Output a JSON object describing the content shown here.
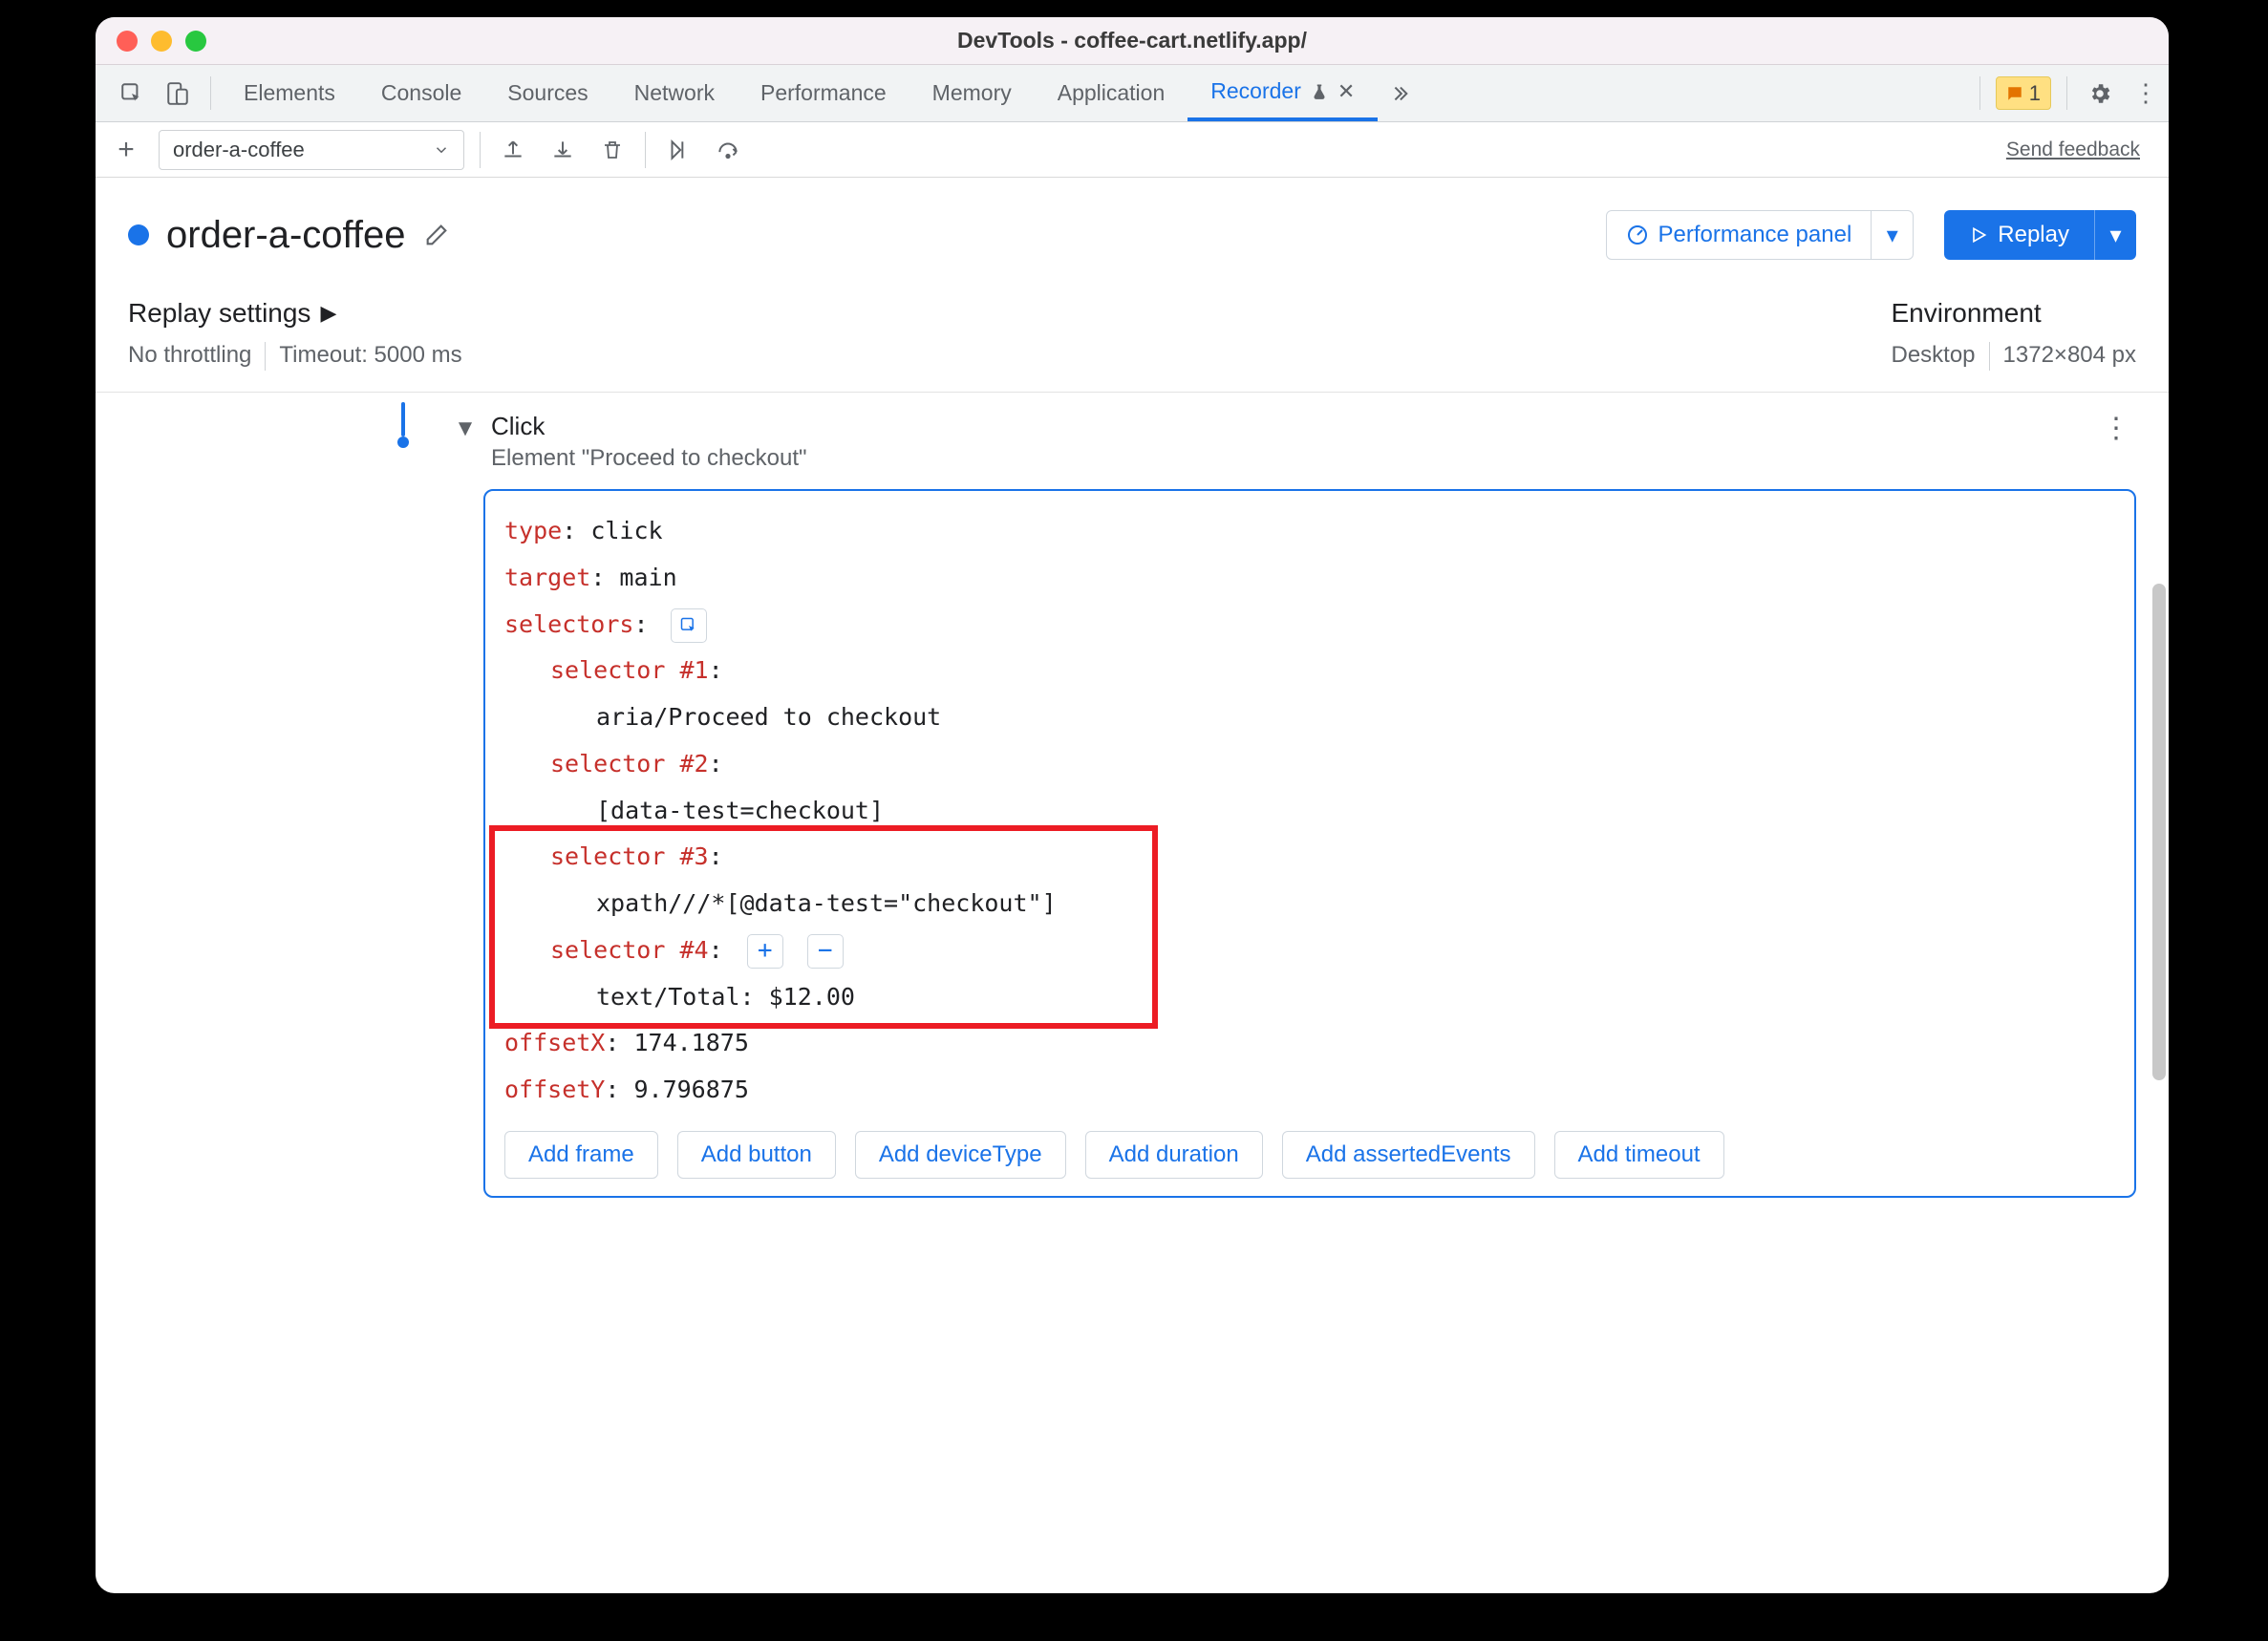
{
  "title": "DevTools - coffee-cart.netlify.app/",
  "tabs": {
    "elements": "Elements",
    "console": "Console",
    "sources": "Sources",
    "network": "Network",
    "performance": "Performance",
    "memory": "Memory",
    "application": "Application",
    "recorder": "Recorder"
  },
  "issues_count": "1",
  "recording_select": "order-a-coffee",
  "send_feedback": "Send feedback",
  "recording_name": "order-a-coffee",
  "perf_panel": "Performance panel",
  "replay_label": "Replay",
  "replay_settings_label": "Replay settings",
  "throttle_label": "No throttling",
  "timeout_label": "Timeout: 5000 ms",
  "environment_label": "Environment",
  "env_device": "Desktop",
  "env_dims": "1372×804 px",
  "step": {
    "title": "Click",
    "subtitle": "Element \"Proceed to checkout\"",
    "type_key": "type",
    "type_val": "click",
    "target_key": "target",
    "target_val": "main",
    "selectors_key": "selectors",
    "sel1_key": "selector #1",
    "sel1_val": "aria/Proceed to checkout",
    "sel2_key": "selector #2",
    "sel2_val": "[data-test=checkout]",
    "sel3_key": "selector #3",
    "sel3_val": "xpath///*[@data-test=\"checkout\"]",
    "sel4_key": "selector #4",
    "sel4_val": "text/Total: $12.00",
    "offx_key": "offsetX",
    "offx_val": "174.1875",
    "offy_key": "offsetY",
    "offy_val": "9.796875"
  },
  "add_buttons": {
    "frame": "Add frame",
    "button": "Add button",
    "deviceType": "Add deviceType",
    "duration": "Add duration",
    "assertedEvents": "Add assertedEvents",
    "timeout": "Add timeout"
  }
}
